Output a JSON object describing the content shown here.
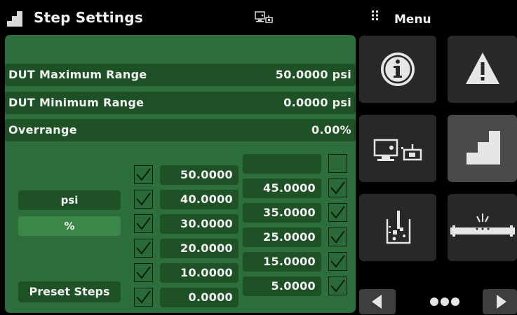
{
  "header": {
    "title": "Step Settings",
    "menu_label": "Menu"
  },
  "settings": {
    "rows": [
      {
        "label": "DUT Maximum Range",
        "value": "50.0000 psi"
      },
      {
        "label": "DUT Minimum Range",
        "value": "0.0000 psi"
      },
      {
        "label": "Overrange",
        "value": "0.00%"
      }
    ],
    "units": {
      "psi": "psi",
      "percent": "%",
      "selected": "%"
    },
    "preset_label": "Preset Steps"
  },
  "steps": {
    "left": [
      {
        "value": "50.0000",
        "checked": true
      },
      {
        "value": "40.0000",
        "checked": true
      },
      {
        "value": "30.0000",
        "checked": true
      },
      {
        "value": "20.0000",
        "checked": true
      },
      {
        "value": "10.0000",
        "checked": true
      },
      {
        "value": "0.0000",
        "checked": true
      }
    ],
    "right": [
      {
        "value": "",
        "checked": false
      },
      {
        "value": "45.0000",
        "checked": true
      },
      {
        "value": "35.0000",
        "checked": true
      },
      {
        "value": "25.0000",
        "checked": true
      },
      {
        "value": "15.0000",
        "checked": true
      },
      {
        "value": "5.0000",
        "checked": true
      }
    ]
  },
  "menu": {
    "tiles": [
      "info-icon",
      "warning-icon",
      "remote-icon",
      "step-icon",
      "beaker-icon",
      "leak-icon"
    ],
    "active_tile": "step-icon",
    "pagination": {
      "pages": 3,
      "current": 2
    }
  },
  "colors": {
    "panel": "#2d6f3c",
    "field": "#1e5126",
    "selected_unit": "#3a8748",
    "tile": "#282828",
    "tile_active": "#4a4a4a"
  }
}
